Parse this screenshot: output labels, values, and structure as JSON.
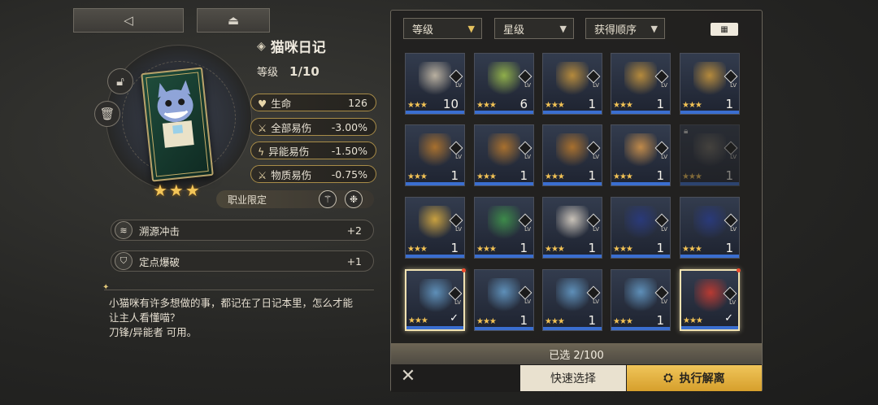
{
  "nav": {
    "back_icon": "back-arrow-icon",
    "home_icon": "eject-icon"
  },
  "item": {
    "name": "猫咪日记",
    "level_label": "等级",
    "level_value": "1/10",
    "stars": "★★★",
    "lock_icon": "lock-icon",
    "delete_icon": "trash-icon"
  },
  "stats": [
    {
      "label": "生命",
      "value": "126",
      "icon": "heart-icon"
    },
    {
      "label": "全部易伤",
      "value": "-3.00%",
      "icon": "blade-icon"
    },
    {
      "label": "异能易伤",
      "value": "-1.50%",
      "icon": "lightning-icon"
    },
    {
      "label": "物质易伤",
      "value": "-0.75%",
      "icon": "blade-icon"
    }
  ],
  "job": {
    "label": "职业限定"
  },
  "skills": [
    {
      "label": "溯源冲击",
      "value": "+2"
    },
    {
      "label": "定点爆破",
      "value": "+1"
    }
  ],
  "description": {
    "line1": "小猫咪有许多想做的事，都记在了日记本里，怎么才能",
    "line2": "让主人看懂喵？",
    "line3": "刀锋/异能者 可用。"
  },
  "filters": {
    "level": "等级",
    "star": "星级",
    "order": "获得顺序"
  },
  "grid_cards": [
    {
      "level": "10",
      "art": "#b9b0a0"
    },
    {
      "level": "6",
      "art": "#8fae4a"
    },
    {
      "level": "1",
      "art": "#b58a3c"
    },
    {
      "level": "1",
      "art": "#b58a3c"
    },
    {
      "level": "1",
      "art": "#b58a3c"
    },
    {
      "level": "1",
      "art": "#a8702e"
    },
    {
      "level": "1",
      "art": "#a8702e"
    },
    {
      "level": "1",
      "art": "#a8702e"
    },
    {
      "level": "1",
      "art": "#c08a4a"
    },
    {
      "level": "1",
      "art": "#6e6a62"
    },
    {
      "level": "1",
      "art": "#c8a040"
    },
    {
      "level": "1",
      "art": "#3d8a4a"
    },
    {
      "level": "1",
      "art": "#c9c2b8"
    },
    {
      "level": "1",
      "art": "#2a3a7a"
    },
    {
      "level": "1",
      "art": "#2a3a7a"
    },
    {
      "level": "",
      "art": "#5e8fb8"
    },
    {
      "level": "1",
      "art": "#5e8fb8"
    },
    {
      "level": "1",
      "art": "#5e8fb8"
    },
    {
      "level": "1",
      "art": "#5e8fb8"
    },
    {
      "level": "",
      "art": "#b83a32"
    }
  ],
  "selection": {
    "text": "已选 2/100"
  },
  "actions": {
    "quick_select": "快速选择",
    "execute": "执行解离"
  },
  "colors": {
    "accent": "#f0c55a",
    "star": "#f3c558",
    "level_bar": "#3a6ed0"
  }
}
